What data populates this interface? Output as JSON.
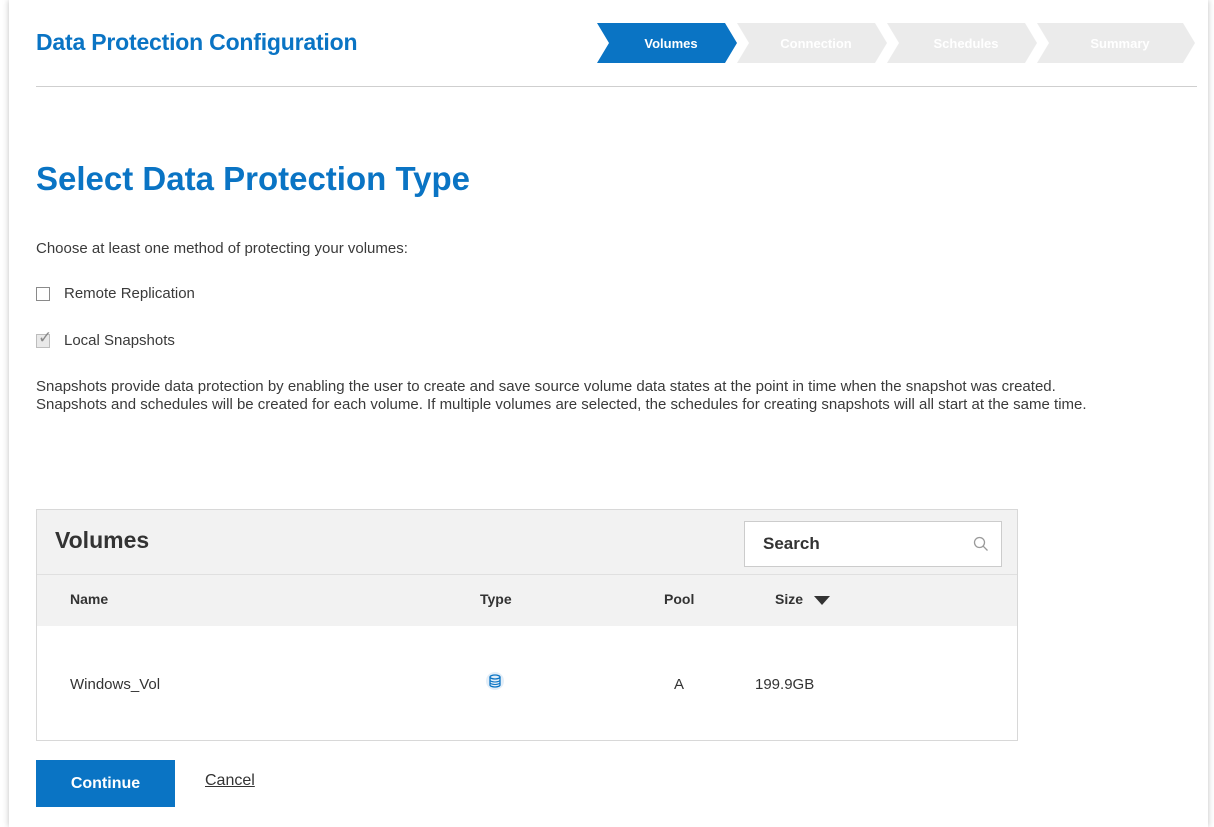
{
  "header": {
    "app_title": "Data Protection Configuration"
  },
  "wizard": {
    "steps": [
      {
        "label": "Volumes",
        "state": "active"
      },
      {
        "label": "Connection",
        "state": "inactive"
      },
      {
        "label": "Schedules",
        "state": "inactive"
      },
      {
        "label": "Summary",
        "state": "inactive"
      }
    ]
  },
  "main": {
    "title": "Select Data Protection Type",
    "prompt": "Choose at least one method of protecting your volumes:",
    "options": [
      {
        "label": "Remote Replication",
        "checked": false
      },
      {
        "label": "Local Snapshots",
        "checked": true
      }
    ],
    "description": [
      "Snapshots provide data protection by enabling the user to create and save source volume data states at the point in time when the snapshot was created.",
      "Snapshots and schedules will be created for each volume. If multiple volumes are selected, the schedules for creating snapshots will all start at the same time."
    ]
  },
  "volumes": {
    "title": "Volumes",
    "search_placeholder": "Search",
    "columns": {
      "name": "Name",
      "type": "Type",
      "pool": "Pool",
      "size": "Size"
    },
    "sort": {
      "column": "Size",
      "direction": "descending"
    },
    "rows": [
      {
        "name": "Windows_Vol",
        "type_icon": "database-icon",
        "pool": "A",
        "size": "199.9GB"
      }
    ]
  },
  "actions": {
    "continue_label": "Continue",
    "cancel_label": "Cancel"
  },
  "colors": {
    "accent": "#0a74c4",
    "inactive_step": "#ebebeb",
    "panel_bg": "#f2f2f2"
  }
}
